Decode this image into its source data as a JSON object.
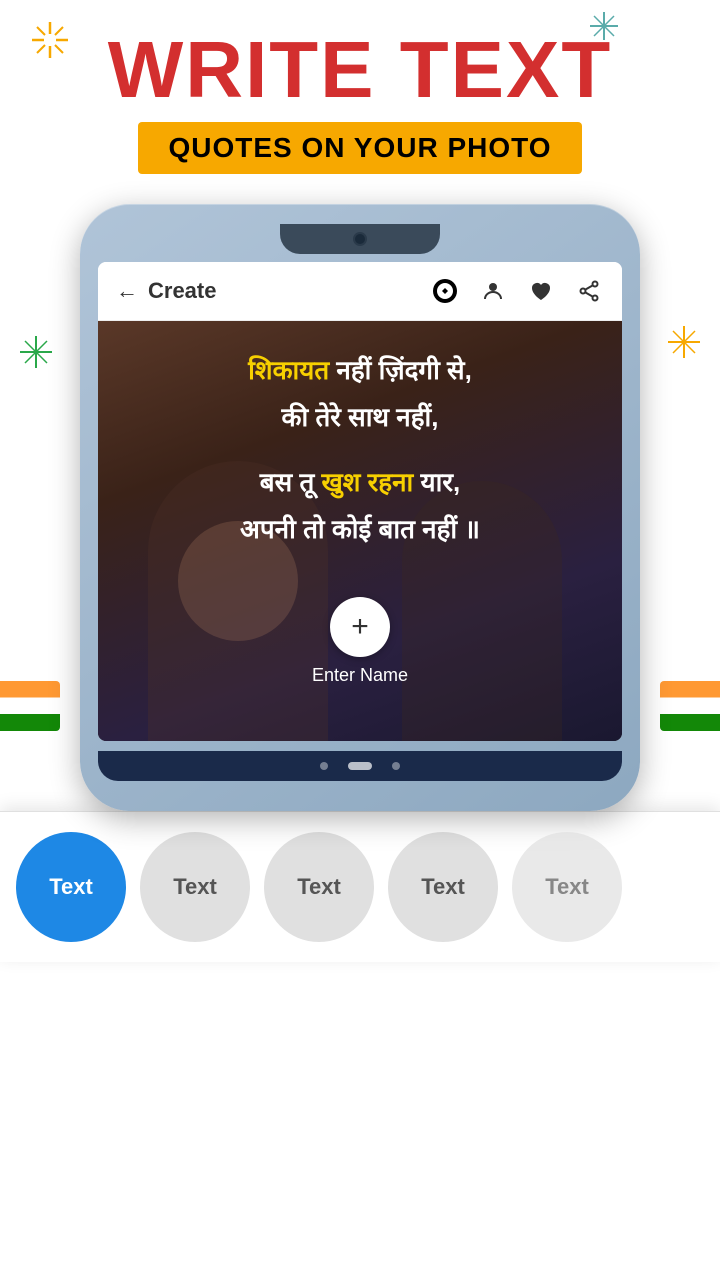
{
  "header": {
    "title_line1": "WRITE TEXT",
    "subtitle": "QUOTES ON YOUR PHOTO"
  },
  "app_bar": {
    "back_label": "←",
    "title": "Create",
    "icons": [
      "edit-circle",
      "user",
      "heart",
      "share"
    ]
  },
  "quote": {
    "lines": [
      {
        "text": "शिकायत",
        "color": "yellow",
        "suffix": " नहीं ज़िंदगी से,",
        "suffix_color": "white"
      },
      {
        "text": "की तेरे साथ नहीं,",
        "color": "white"
      },
      {
        "text": "बस तू ",
        "color": "white",
        "highlight": "खुश रहना",
        "highlight_color": "yellow",
        "suffix": " यार,",
        "suffix_color": "white"
      },
      {
        "text": "अपनी तो कोई बात नहीं ॥",
        "color": "white"
      }
    ]
  },
  "enter_name": {
    "button_label": "+",
    "label": "Enter Name"
  },
  "text_options": [
    {
      "label": "Text",
      "active": true
    },
    {
      "label": "Text",
      "active": false
    },
    {
      "label": "Text",
      "active": false
    },
    {
      "label": "Text",
      "active": false
    },
    {
      "label": "Text",
      "active": false
    }
  ],
  "colors": {
    "accent_blue": "#1e88e5",
    "accent_red": "#d32f2f",
    "accent_yellow": "#f7a800",
    "quote_yellow": "#f7d000",
    "text_inactive_bg": "#e0e0e0"
  }
}
